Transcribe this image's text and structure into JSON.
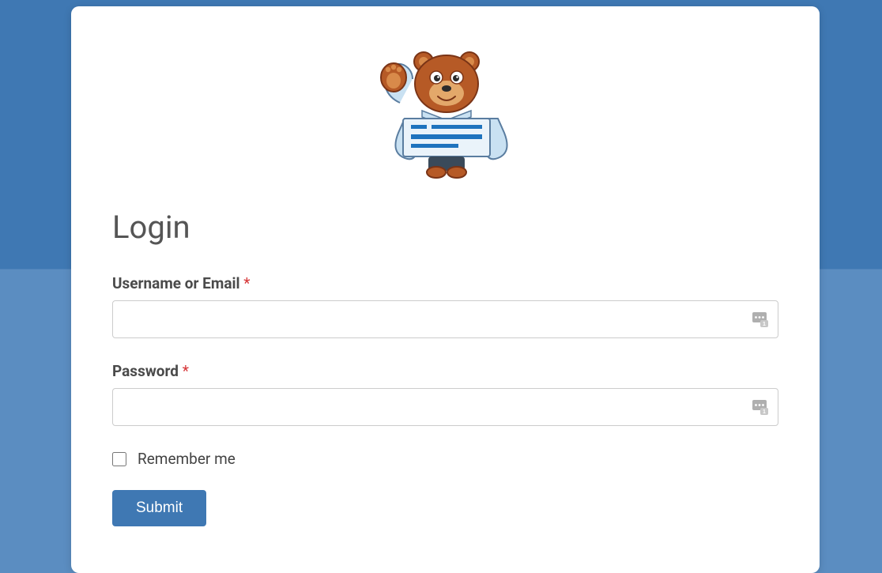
{
  "form": {
    "title": "Login",
    "username": {
      "label": "Username or Email",
      "required_mark": "*",
      "value": "",
      "placeholder": ""
    },
    "password": {
      "label": "Password",
      "required_mark": "*",
      "value": "",
      "placeholder": ""
    },
    "remember": {
      "label": "Remember me",
      "checked": false
    },
    "submit_label": "Submit"
  },
  "icons": {
    "logo": "wpforms-bear-mascot",
    "password_manager": "password-manager-badge"
  },
  "colors": {
    "accent": "#3f78b3",
    "required": "#d63638"
  }
}
